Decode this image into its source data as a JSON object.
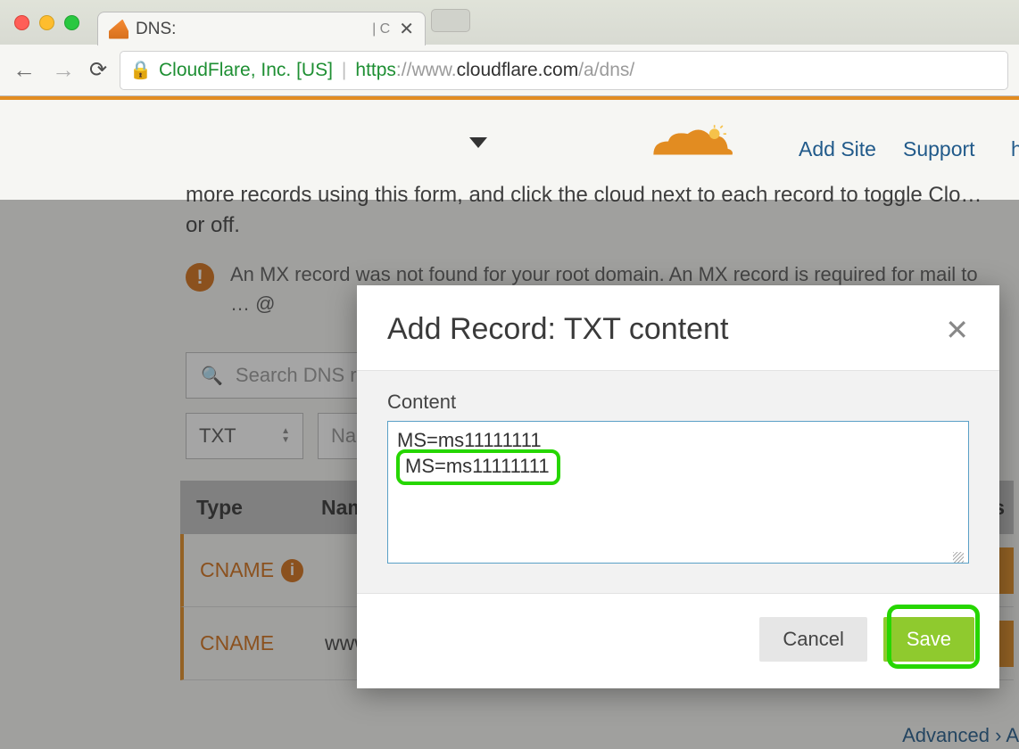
{
  "browser": {
    "tab_title": "DNS:",
    "tab_right_hint": "| C",
    "org_name": "CloudFlare, Inc. [US]",
    "url_proto": "https",
    "url_prefix": "://",
    "url_host_dim": "www.",
    "url_host": "cloudflare.com",
    "url_path": "/a/dns/"
  },
  "nav": {
    "add_site": "Add Site",
    "support": "Support",
    "extra": "h"
  },
  "page": {
    "intro": "more records using this form, and click the cloud next to each record to toggle Clo… or off.",
    "warning": "An MX record was not found for your root domain. An MX record is required for mail to … @",
    "search_placeholder": "Search DNS re",
    "type_select_value": "TXT",
    "name_placeholder": "Na",
    "table": {
      "head_type": "Type",
      "head_name": "Nam",
      "head_s": "s",
      "rows": [
        {
          "type": "CNAME",
          "info": true,
          "name": ""
        },
        {
          "type": "CNAME",
          "info": false,
          "name": "www"
        }
      ]
    },
    "advanced": "Advanced  ›   A"
  },
  "modal": {
    "title": "Add Record: TXT content",
    "content_label": "Content",
    "content_value": "MS=ms11111111",
    "cancel": "Cancel",
    "save": "Save"
  }
}
